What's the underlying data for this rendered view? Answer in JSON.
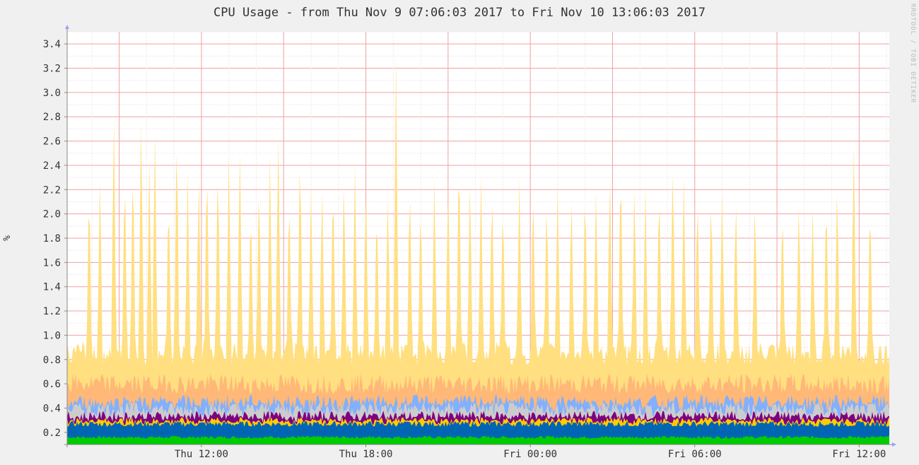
{
  "chart_data": {
    "type": "area",
    "title": "CPU Usage - from Thu Nov  9 07:06:03 2017 to Fri Nov 10 13:06:03 2017",
    "ylabel": "%",
    "watermark": "RRDTOOL / TOBI OETIKER",
    "ylim": [
      0.1,
      3.5
    ],
    "yticks": [
      "0.2",
      "0.4",
      "0.6",
      "0.8",
      "1.0",
      "1.2",
      "1.4",
      "1.6",
      "1.8",
      "2.0",
      "2.2",
      "2.4",
      "2.6",
      "2.8",
      "3.0",
      "3.2",
      "3.4"
    ],
    "x_range_hours": [
      "2017-11-09 07:06",
      "2017-11-10 13:06"
    ],
    "xticks": [
      {
        "label": "Thu 12:00",
        "hour": 12
      },
      {
        "label": "Thu 18:00",
        "hour": 18
      },
      {
        "label": "Fri 00:00",
        "hour": 24
      },
      {
        "label": "Fri 06:00",
        "hour": 30
      },
      {
        "label": "Fri 12:00",
        "hour": 36
      }
    ],
    "grid": true,
    "colors": {
      "background": "#f0f0f0",
      "plot": "#ffffff",
      "minor_grid": "#ebd8d8",
      "major_grid": "#f0a0a0",
      "axis": "#888888"
    },
    "series": [
      {
        "color": "#00cc00",
        "typical_top": 0.16
      },
      {
        "color": "#0066b3",
        "typical_top": 0.27
      },
      {
        "color": "#ffcc00",
        "typical_top": 0.29
      },
      {
        "color": "#7e0080",
        "typical_top": 0.33
      },
      {
        "color": "#cccccc",
        "typical_top": 0.39
      },
      {
        "color": "#80b0ff",
        "typical_top": 0.44
      },
      {
        "color": "#ffb878",
        "typical_top": 0.6
      },
      {
        "color": "#ffdf80",
        "typical_top": 0.85,
        "spike_max": 3.3
      }
    ],
    "spikes": [
      {
        "hour": 7.9,
        "value": 2.38
      },
      {
        "hour": 8.3,
        "value": 2.45
      },
      {
        "hour": 8.8,
        "value": 2.95
      },
      {
        "hour": 9.2,
        "value": 2.52
      },
      {
        "hour": 9.5,
        "value": 2.6
      },
      {
        "hour": 9.8,
        "value": 2.98
      },
      {
        "hour": 10.1,
        "value": 2.45
      },
      {
        "hour": 10.3,
        "value": 2.8
      },
      {
        "hour": 10.8,
        "value": 2.3
      },
      {
        "hour": 11.1,
        "value": 2.88
      },
      {
        "hour": 11.5,
        "value": 2.4
      },
      {
        "hour": 11.9,
        "value": 2.45
      },
      {
        "hour": 12.2,
        "value": 2.6
      },
      {
        "hour": 12.6,
        "value": 2.58
      },
      {
        "hour": 13.0,
        "value": 2.56
      },
      {
        "hour": 13.4,
        "value": 2.71
      },
      {
        "hour": 13.8,
        "value": 2.2
      },
      {
        "hour": 14.1,
        "value": 2.42
      },
      {
        "hour": 14.5,
        "value": 2.55
      },
      {
        "hour": 14.8,
        "value": 2.78
      },
      {
        "hour": 15.2,
        "value": 2.3
      },
      {
        "hour": 15.6,
        "value": 2.7
      },
      {
        "hour": 16.0,
        "value": 2.3
      },
      {
        "hour": 16.4,
        "value": 2.35
      },
      {
        "hour": 16.8,
        "value": 2.43
      },
      {
        "hour": 17.2,
        "value": 2.45
      },
      {
        "hour": 17.6,
        "value": 2.4
      },
      {
        "hour": 18.0,
        "value": 2.4
      },
      {
        "hour": 18.4,
        "value": 2.2
      },
      {
        "hour": 18.8,
        "value": 2.28
      },
      {
        "hour": 19.1,
        "value": 3.3
      },
      {
        "hour": 19.6,
        "value": 2.4
      },
      {
        "hour": 20.0,
        "value": 2.25
      },
      {
        "hour": 20.5,
        "value": 2.35
      },
      {
        "hour": 21.0,
        "value": 2.4
      },
      {
        "hour": 21.4,
        "value": 2.7
      },
      {
        "hour": 21.8,
        "value": 2.4
      },
      {
        "hour": 22.2,
        "value": 2.38
      },
      {
        "hour": 22.6,
        "value": 2.35
      },
      {
        "hour": 23.0,
        "value": 2.25
      },
      {
        "hour": 23.6,
        "value": 2.3
      },
      {
        "hour": 24.1,
        "value": 2.35
      },
      {
        "hour": 24.6,
        "value": 2.28
      },
      {
        "hour": 25.0,
        "value": 2.3
      },
      {
        "hour": 25.5,
        "value": 2.3
      },
      {
        "hour": 26.0,
        "value": 2.38
      },
      {
        "hour": 26.4,
        "value": 2.3
      },
      {
        "hour": 26.9,
        "value": 2.45
      },
      {
        "hour": 27.3,
        "value": 2.6
      },
      {
        "hour": 27.8,
        "value": 2.37
      },
      {
        "hour": 28.2,
        "value": 2.28
      },
      {
        "hour": 28.7,
        "value": 2.4
      },
      {
        "hour": 29.2,
        "value": 2.6
      },
      {
        "hour": 29.6,
        "value": 2.3
      },
      {
        "hour": 30.1,
        "value": 2.3
      },
      {
        "hour": 30.6,
        "value": 2.3
      },
      {
        "hour": 31.0,
        "value": 2.25
      },
      {
        "hour": 31.5,
        "value": 2.28
      },
      {
        "hour": 32.2,
        "value": 2.25
      },
      {
        "hour": 33.2,
        "value": 2.2
      },
      {
        "hour": 33.8,
        "value": 2.22
      },
      {
        "hour": 34.3,
        "value": 2.15
      },
      {
        "hour": 34.8,
        "value": 2.3
      },
      {
        "hour": 35.2,
        "value": 2.4
      },
      {
        "hour": 35.8,
        "value": 2.71
      },
      {
        "hour": 36.4,
        "value": 2.25
      }
    ]
  }
}
